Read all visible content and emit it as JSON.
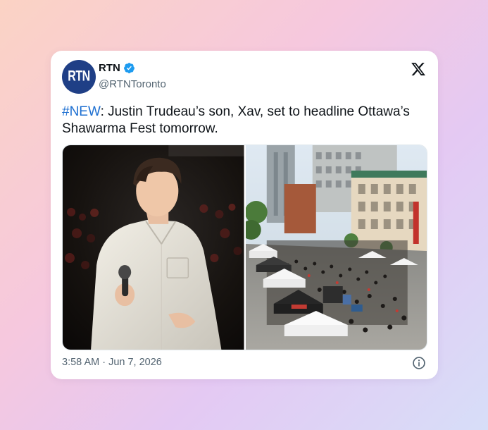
{
  "tweet": {
    "avatar_text": "RTN",
    "display_name": "RTN",
    "handle": "@RTNToronto",
    "hashtag": "#NEW",
    "body": ": Justin Trudeau’s son, Xav, set to headline Ottawa’s Shawarma Fest tomorrow.",
    "timestamp": "3:58 AM · Jun 7, 2026",
    "verified": true
  },
  "icons": {
    "brand": "x-logo-icon",
    "verified": "verified-badge-icon",
    "info": "info-icon"
  },
  "colors": {
    "hashtag": "#1d6fd1",
    "verified": "#1d9bf0",
    "avatar_bg": "#1f3f86",
    "text_primary": "#0f1419",
    "text_secondary": "#536471"
  }
}
